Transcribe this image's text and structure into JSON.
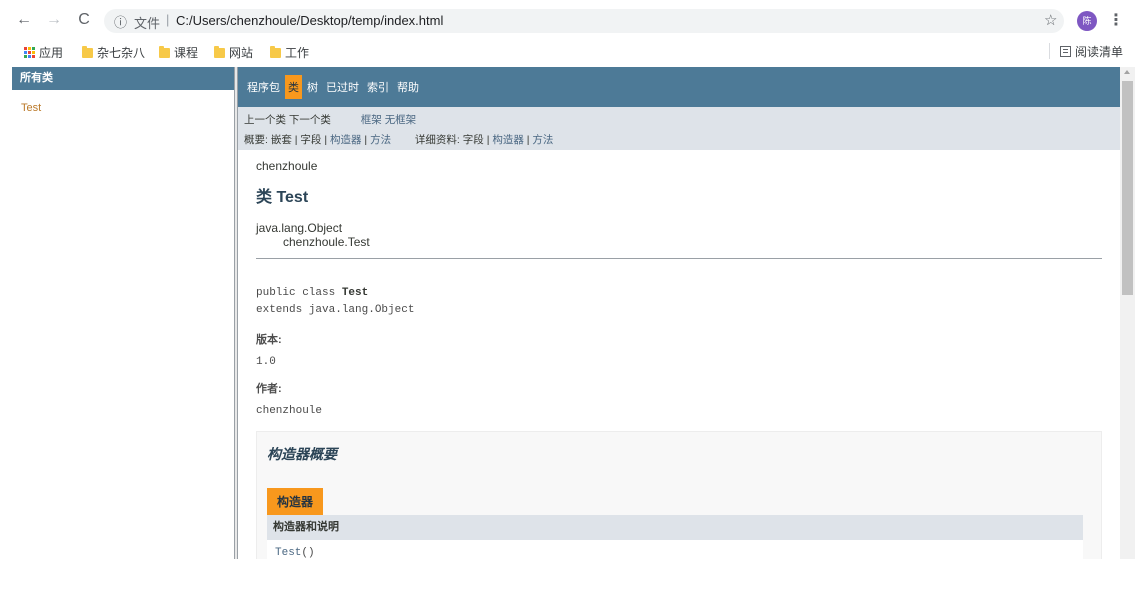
{
  "browser": {
    "back_icon": "←",
    "forward_icon": "→",
    "reload_icon": "C",
    "info_icon": "ⓘ",
    "scheme_label": "文件",
    "separator": "|",
    "url": "C:/Users/chenzhoule/Desktop/temp/index.html",
    "star_icon": "☆",
    "avatar_text": "陈",
    "menu_icon": "⋮"
  },
  "bookmarks": {
    "apps": "应用",
    "items": [
      "杂七杂八",
      "课程",
      "网站",
      "工作"
    ],
    "reading_list": "阅读清单"
  },
  "left_frame": {
    "header": "所有类",
    "classes": [
      "Test"
    ]
  },
  "nav": {
    "items": [
      "程序包",
      "类",
      "树",
      "已过时",
      "索引",
      "帮助"
    ],
    "active": "类"
  },
  "subnav": {
    "prev_class": "上一个类",
    "next_class": "下一个类",
    "frames": "框架",
    "no_frames": "无框架",
    "summary_label": "概要:",
    "summary_nested": "嵌套",
    "summary_field": "字段",
    "summary_constructor": "构造器",
    "summary_method": "方法",
    "detail_label": "详细资料:",
    "detail_field": "字段",
    "detail_constructor": "构造器",
    "detail_method": "方法",
    "pipe": "|"
  },
  "doc": {
    "package": "chenzhoule",
    "title": "类 Test",
    "inherit_parent": "java.lang.Object",
    "inherit_child": "chenzhoule.Test",
    "sig_prefix": "public class ",
    "sig_name": "Test",
    "sig_extends": "extends java.lang.Object",
    "version_label": "版本:",
    "version_value": "1.0",
    "author_label": "作者:",
    "author_value": "chenzhoule"
  },
  "constructor_summary": {
    "title": "构造器概要",
    "caption": "构造器",
    "column_header": "构造器和说明",
    "rows": [
      {
        "name": "Test",
        "params": "()"
      }
    ]
  },
  "colors": {
    "header_blue": "#4d7a97",
    "accent_orange": "#f8981d",
    "subnav_gray": "#dee3e9",
    "link": "#4a6782",
    "left_link": "#bb7a2a"
  }
}
